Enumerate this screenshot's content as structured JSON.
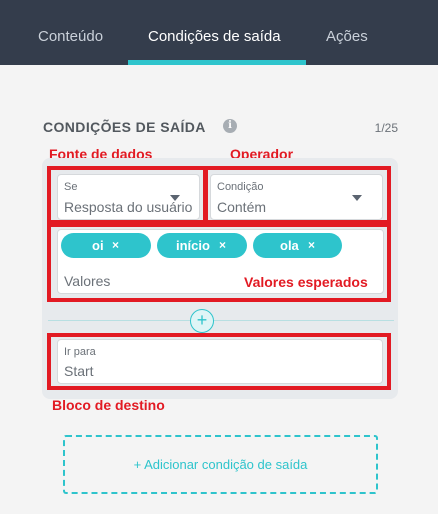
{
  "tabs": [
    {
      "label": "Conteúdo",
      "active": false
    },
    {
      "label": "Condições de saída",
      "active": true
    },
    {
      "label": "Ações",
      "active": false
    }
  ],
  "section": {
    "title": "CONDIÇÕES DE SAÍDA",
    "info_icon": "info-icon",
    "count": "1/25"
  },
  "annotations": {
    "data_source": "Fonte de dados",
    "operator": "Operador",
    "expected_values": "Valores esperados",
    "destination_block": "Bloco de destino"
  },
  "condition": {
    "source": {
      "label": "Se",
      "value": "Resposta do usuário"
    },
    "operator": {
      "label": "Condição",
      "value": "Contém"
    },
    "values": {
      "chips": [
        {
          "text": "oi",
          "remove": "×"
        },
        {
          "text": "início",
          "remove": "×"
        },
        {
          "text": "ola",
          "remove": "×"
        }
      ],
      "placeholder": "Valores"
    },
    "add_icon": "plus",
    "goto": {
      "label": "Ir para",
      "value": "Start"
    }
  },
  "add_button_label": "+ Adicionar condição de saída",
  "colors": {
    "accent": "#2ec4cc",
    "header_bg": "#343d4c",
    "annotation": "#e21a23"
  }
}
